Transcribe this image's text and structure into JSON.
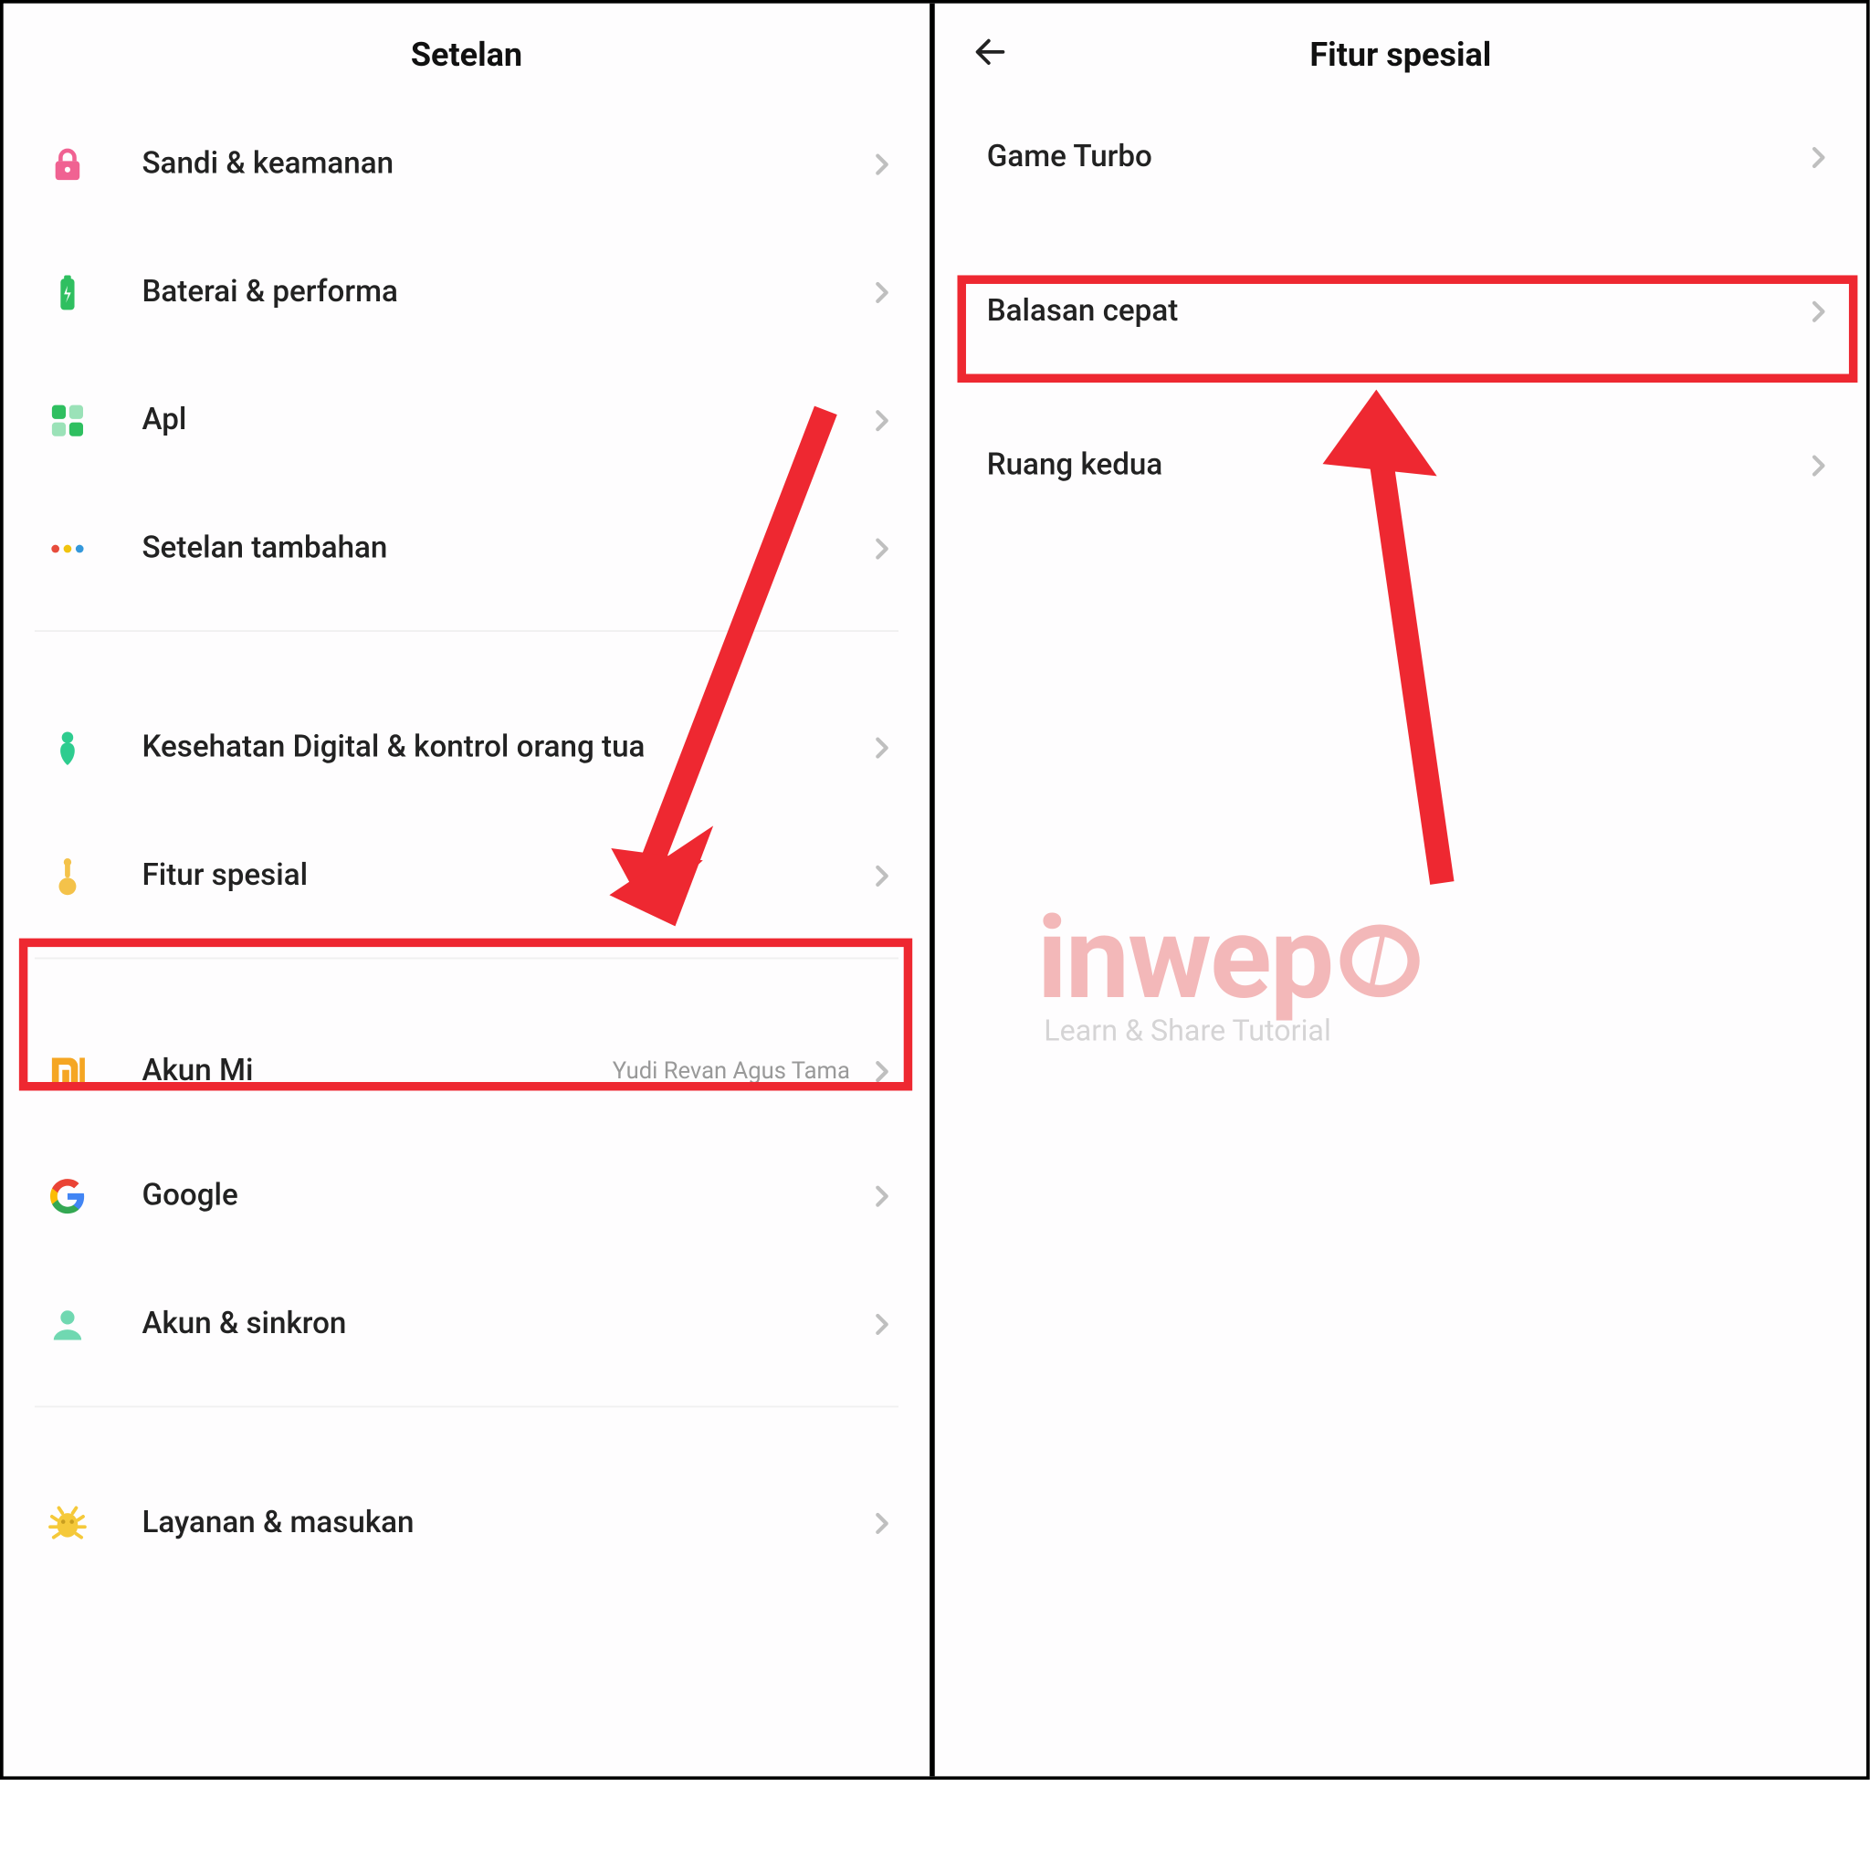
{
  "left": {
    "title": "Setelan",
    "items": {
      "security": "Sandi & keamanan",
      "battery": "Baterai & performa",
      "apps": "Apl",
      "additional": "Setelan tambahan",
      "digital": "Kesehatan Digital & kontrol orang tua",
      "special": "Fitur spesial",
      "mi_account": "Akun Mi",
      "mi_account_value": "Yudi Revan Agus Tama",
      "google": "Google",
      "sync": "Akun & sinkron",
      "feedback": "Layanan & masukan"
    }
  },
  "right": {
    "title": "Fitur spesial",
    "items": {
      "game_turbo": "Game Turbo",
      "quick_reply": "Balasan cepat",
      "second_space": "Ruang kedua"
    }
  },
  "watermark": {
    "brand": "inwep",
    "tagline": "Learn & Share Tutorial"
  },
  "colors": {
    "highlight": "#ee2831",
    "lock": "#f06292",
    "battery": "#2fbf60",
    "apps": "#2fbf60",
    "dots_r": "#e74c3c",
    "dots_y": "#f1c40f",
    "dots_b": "#3498db",
    "health": "#2ecc8f",
    "special": "#f4c24a",
    "mi": "#f5a623",
    "account": "#70d8b1",
    "bug": "#f5c93a"
  }
}
